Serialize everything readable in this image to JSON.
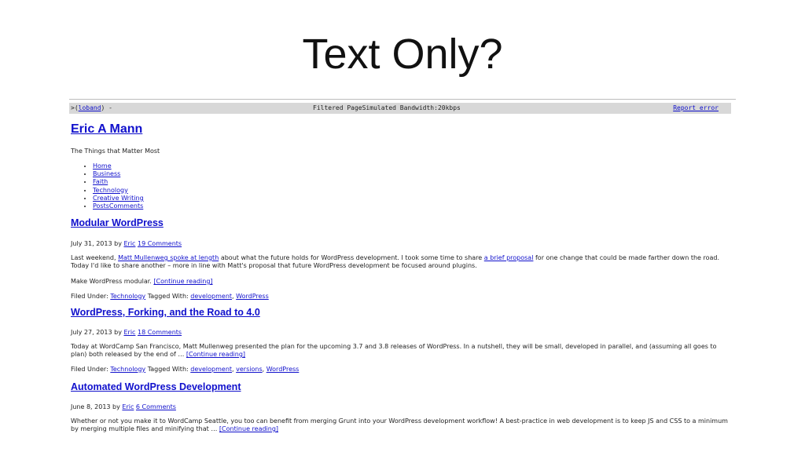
{
  "slide": {
    "title": "Text Only?"
  },
  "loband": {
    "prefix": ">(",
    "link": "loband",
    "suffix": ") -",
    "status": "Filtered PageSimulated Bandwidth:20kbps",
    "report": "Report error"
  },
  "blog": {
    "title": "Eric A Mann",
    "tagline": "The Things that Matter Most",
    "nav": [
      "Home",
      "Business",
      "Faith",
      "Technology",
      "Creative Writing",
      "PostsComments"
    ]
  },
  "posts": [
    {
      "title": "Modular WordPress",
      "date": "July 31, 2013",
      "by": "by",
      "author": "Eric",
      "comments": "19 Comments",
      "excerpt_a": "Last weekend,",
      "excerpt_link1": "Matt Mullenweg spoke at length",
      "excerpt_b": "about what the future holds for WordPress development.  I took some time to share",
      "excerpt_link2": "a brief proposal",
      "excerpt_c": "for one change that could be made farther down the road.  Today I'd like to share another – more in line with Matt's proposal that future WordPress development be focused around plugins.",
      "extra": "Make WordPress modular.",
      "continue": "[Continue reading]",
      "filed_label": "Filed Under:",
      "category": "Technology",
      "tagged_label": "Tagged With:",
      "tags": [
        "development",
        "WordPress"
      ]
    },
    {
      "title": "WordPress, Forking, and the Road to 4.0",
      "date": "July 27, 2013",
      "by": "by",
      "author": "Eric",
      "comments": "18 Comments",
      "excerpt": "Today at WordCamp San Francisco, Matt Mullenweg presented the plan for the upcoming 3.7 and 3.8 releases of WordPress.  In a nutshell, they will be small, developed in parallel, and (assuming all goes to plan) both released by the end of …",
      "continue": "[Continue reading]",
      "filed_label": "Filed Under:",
      "category": "Technology",
      "tagged_label": "Tagged With:",
      "tags": [
        "development",
        "versions",
        "WordPress"
      ]
    },
    {
      "title": "Automated WordPress Development",
      "date": "June 8, 2013",
      "by": "by",
      "author": "Eric",
      "comments": "6 Comments",
      "excerpt": "Whether or not you make it to WordCamp Seattle, you too can benefit from merging Grunt into your WordPress development workflow! A best-practice in web development is to keep JS and CSS to a minimum by merging multiple files and minifying that …",
      "continue": "[Continue reading]"
    }
  ]
}
